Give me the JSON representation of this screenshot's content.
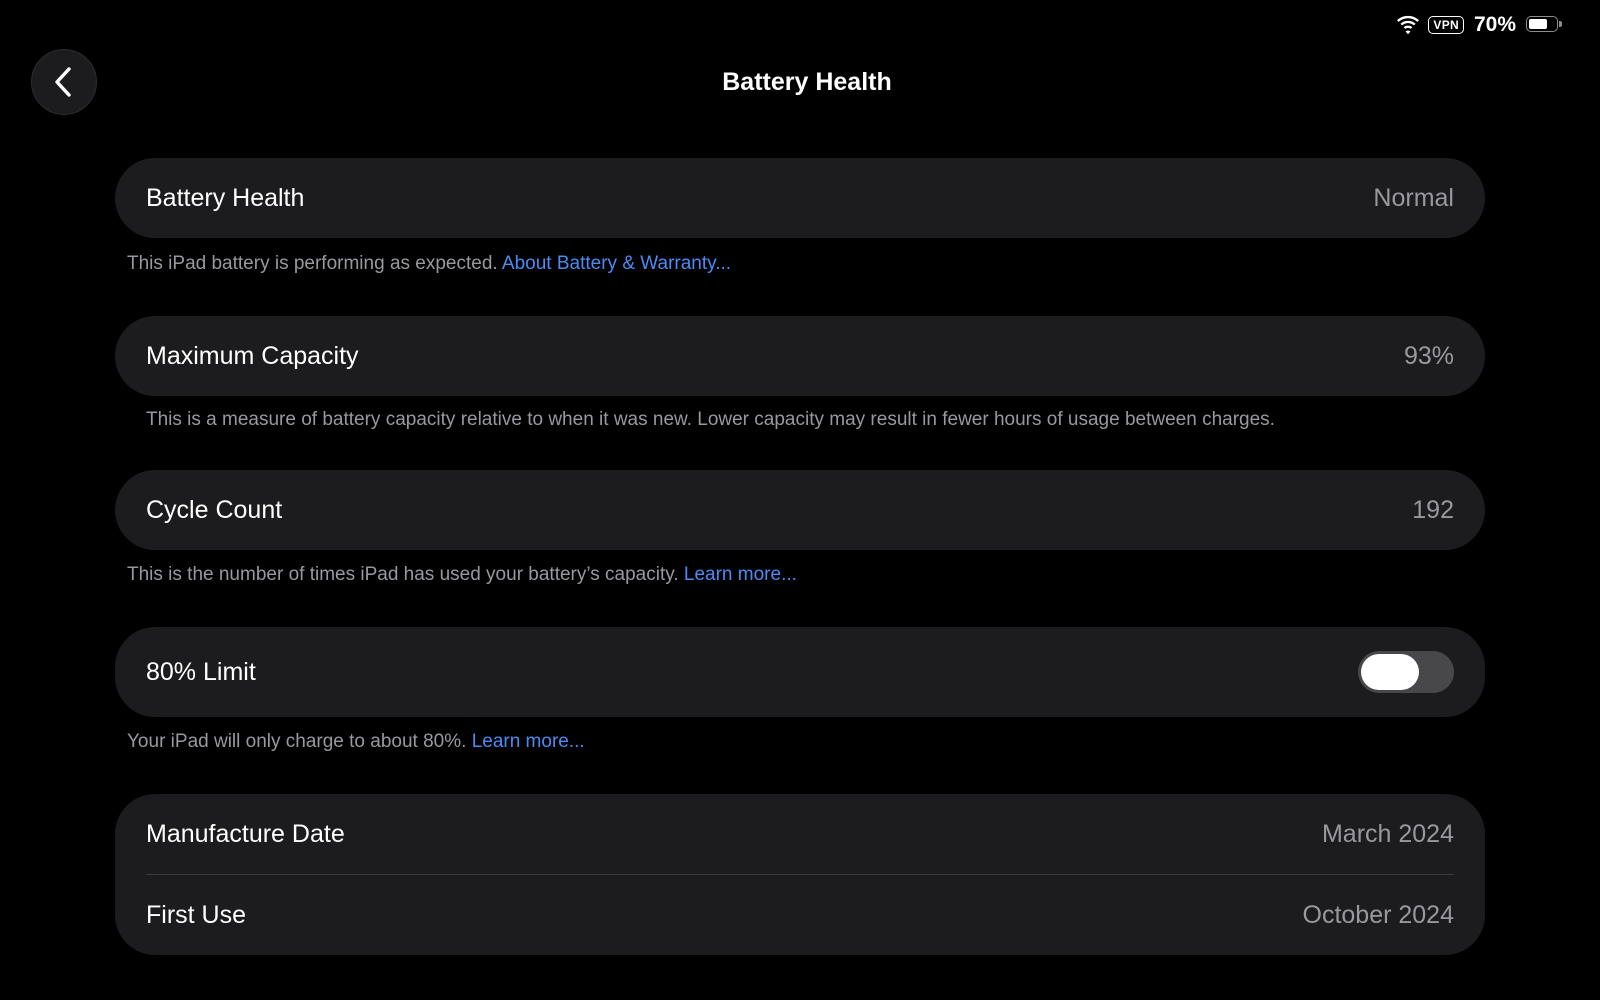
{
  "status_bar": {
    "wifi_icon": "wifi-icon",
    "vpn_label": "VPN",
    "battery_percent": "70%",
    "battery_level": 0.7
  },
  "header": {
    "back_icon": "chevron-left-icon",
    "title": "Battery Health"
  },
  "battery_health": {
    "label": "Battery Health",
    "value": "Normal",
    "footnote": "This iPad battery is performing as expected.",
    "link": "About Battery & Warranty..."
  },
  "maximum_capacity": {
    "label": "Maximum Capacity",
    "value": "93%",
    "footnote": "This is a measure of battery capacity relative to when it was new. Lower capacity may result in fewer hours of usage between charges."
  },
  "cycle_count": {
    "label": "Cycle Count",
    "value": "192",
    "footnote": "This is the number of times iPad has used your battery’s capacity.",
    "link": "Learn more..."
  },
  "limit_80": {
    "label": "80% Limit",
    "enabled": false,
    "footnote": "Your iPad will only charge to about 80%.",
    "link": "Learn more..."
  },
  "dates": {
    "manufacture_label": "Manufacture Date",
    "manufacture_value": "March 2024",
    "first_use_label": "First Use",
    "first_use_value": "October 2024"
  },
  "colors": {
    "background": "#000000",
    "card": "#1c1c1e",
    "secondary_text": "#98989f",
    "link": "#4c8bf5",
    "toggle_off": "#48484a"
  }
}
